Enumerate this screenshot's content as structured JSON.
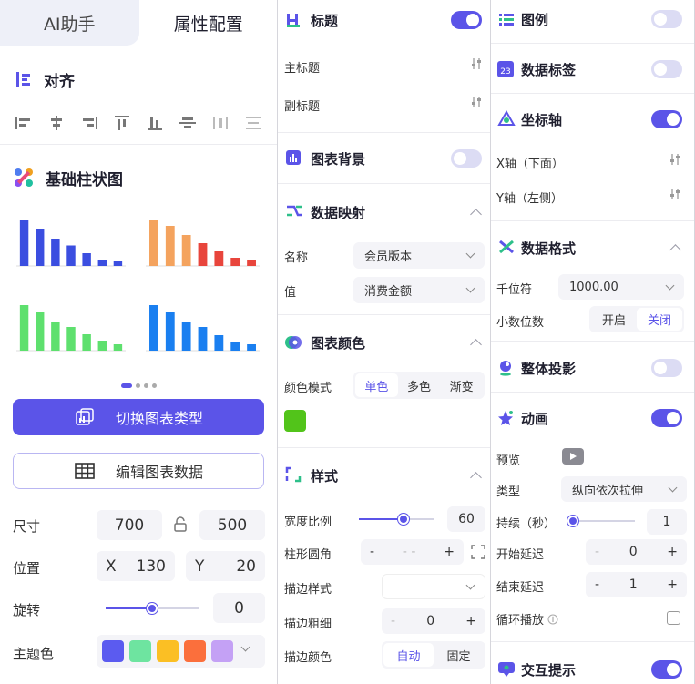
{
  "tabs": {
    "ai": "AI助手",
    "config": "属性配置"
  },
  "align": {
    "title": "对齐"
  },
  "chart": {
    "title": "基础柱状图",
    "switch_label": "切换图表类型",
    "edit_label": "编辑图表数据"
  },
  "dims": {
    "size_label": "尺寸",
    "width": "700",
    "height": "500",
    "pos_label": "位置",
    "x_prefix": "X",
    "x": "130",
    "y_prefix": "Y",
    "y": "20",
    "rotate_label": "旋转",
    "rotate": "0",
    "rotate_level": 0.5,
    "theme_label": "主题色",
    "theme_colors": [
      "#5b5bf0",
      "#6ee4a0",
      "#fbbf24",
      "#fb6f3c",
      "#c4a1f5"
    ]
  },
  "thumbs": {
    "blue": {
      "color": "#3b4ee0",
      "values": [
        100,
        82,
        60,
        45,
        28,
        14,
        10
      ]
    },
    "orange": {
      "color_top": "#f4a35e",
      "color_bottom": "#e8453c",
      "values": [
        100,
        88,
        68,
        50,
        32,
        18,
        12
      ]
    },
    "green": {
      "color": "#5ee06e",
      "values": [
        100,
        84,
        64,
        52,
        36,
        22,
        14
      ]
    },
    "azure": {
      "color": "#1a7ff0",
      "values": [
        100,
        84,
        64,
        52,
        34,
        20,
        14
      ]
    }
  },
  "title_sec": {
    "label": "标题",
    "on": true,
    "main": "主标题",
    "sub": "副标题"
  },
  "bg_sec": {
    "label": "图表背景",
    "on": false
  },
  "mapping": {
    "label": "数据映射",
    "name_label": "名称",
    "name_value": "会员版本",
    "value_label": "值",
    "value_value": "消费金额"
  },
  "colors_sec": {
    "label": "图表颜色",
    "mode_label": "颜色模式",
    "modes": [
      "单色",
      "多色",
      "渐变"
    ],
    "active_mode": 0,
    "color": "#52c41a"
  },
  "style_sec": {
    "label": "样式",
    "width_label": "宽度比例",
    "width_value": "60",
    "width_level": 0.6,
    "radius_label": "柱形圆角",
    "radius_value": "- -",
    "stroke_style_label": "描边样式",
    "stroke_width_label": "描边粗细",
    "stroke_width_value": "0",
    "stroke_color_label": "描边颜色",
    "stroke_color_opts": [
      "自动",
      "固定"
    ]
  },
  "legend": {
    "label": "图例",
    "on": false
  },
  "data_label": {
    "label": "数据标签",
    "on": false,
    "icon_text": "23"
  },
  "axis": {
    "label": "坐标轴",
    "on": true,
    "x": "X轴（下面）",
    "y": "Y轴（左侧）"
  },
  "format": {
    "label": "数据格式",
    "thousands_label": "千位符",
    "thousands_value": "1000.00",
    "decimal_label": "小数位数",
    "decimal_opts": [
      "开启",
      "关闭"
    ]
  },
  "shadow": {
    "label": "整体投影",
    "on": false
  },
  "animation": {
    "label": "动画",
    "on": true,
    "preview_label": "预览",
    "type_label": "类型",
    "type_value": "纵向依次拉伸",
    "duration_label": "持续（秒）",
    "duration_value": "1",
    "duration_level": 0.05,
    "delay_label": "开始延迟",
    "delay_value": "0",
    "end_delay_label": "结束延迟",
    "end_delay_value": "1",
    "loop_label": "循环播放"
  },
  "tooltip": {
    "label": "交互提示",
    "on": true
  },
  "symbols": {
    "minus": "-",
    "plus": "+"
  }
}
